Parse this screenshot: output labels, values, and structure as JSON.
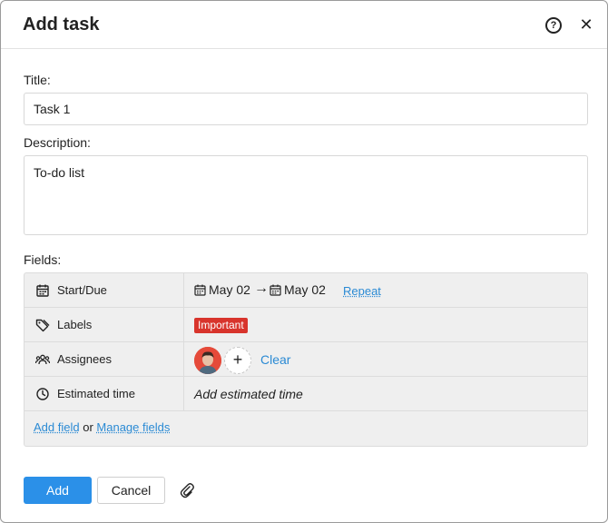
{
  "dialog": {
    "title": "Add task"
  },
  "form": {
    "title_label": "Title:",
    "title_value": "Task 1",
    "description_label": "Description:",
    "description_value": "To-do list",
    "fields_label": "Fields:"
  },
  "fields": {
    "start_due": {
      "label": "Start/Due",
      "start": "May 02",
      "due": "May 02",
      "arrow": "→",
      "repeat": "Repeat"
    },
    "labels": {
      "label": "Labels",
      "badge": "Important",
      "badge_color": "#d8342c"
    },
    "assignees": {
      "label": "Assignees",
      "add": "+",
      "clear": "Clear"
    },
    "estimated_time": {
      "label": "Estimated time",
      "placeholder": "Add estimated time"
    },
    "footer": {
      "add_field": "Add field",
      "or": "or",
      "manage_fields": "Manage fields"
    }
  },
  "buttons": {
    "add": "Add",
    "cancel": "Cancel"
  },
  "icons": {
    "help": "help-icon",
    "close": "close-icon",
    "calendar": "calendar-icon",
    "tag": "tag-icon",
    "users": "users-icon",
    "clock": "clock-icon",
    "paperclip": "paperclip-icon"
  },
  "colors": {
    "accent": "#2b90e8",
    "link": "#2a8ad4"
  }
}
